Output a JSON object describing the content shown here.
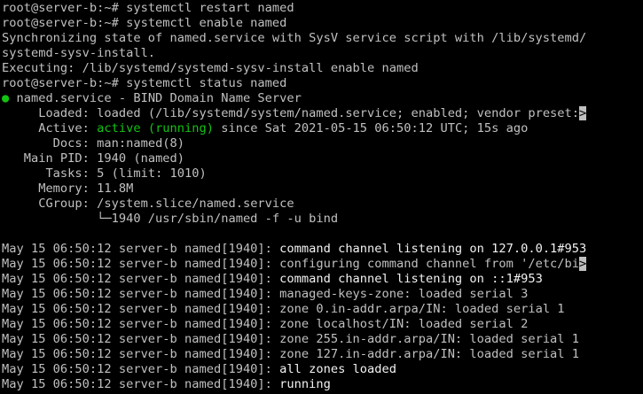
{
  "colors": {
    "background": "#000000",
    "text": "#c0c0c0",
    "green": "#13c313",
    "bright": "#f2f2f2"
  },
  "session": {
    "cmd1": {
      "prompt": "root@server-b:~# ",
      "command": "systemctl restart named"
    },
    "cmd2": {
      "prompt": "root@server-b:~# ",
      "command": "systemctl enable named"
    },
    "sync1": "Synchronizing state of named.service with SysV service script with /lib/systemd/",
    "sync2": "systemd-sysv-install.",
    "exec": "Executing: /lib/systemd/systemd-sysv-install enable named",
    "cmd3": {
      "prompt": "root@server-b:~# ",
      "command": "systemctl status named"
    }
  },
  "status": {
    "dot": "●",
    "unit": " named.service - BIND Domain Name Server",
    "loaded_label": "     Loaded: ",
    "loaded_value": "loaded (/lib/systemd/system/named.service; enabled; vendor preset:",
    "overflow_marker": ">",
    "active_label": "     Active: ",
    "active_state": "active (running)",
    "active_since": " since Sat 2021-05-15 06:50:12 UTC; 15s ago",
    "docs_label": "       Docs: ",
    "docs_value": "man:named(8)",
    "pid_label": "   Main PID: ",
    "pid_value": "1940 (named)",
    "tasks_label": "      Tasks: ",
    "tasks_value": "5 (limit: 1010)",
    "memory_label": "     Memory: ",
    "memory_value": "11.8M",
    "cgroup_label": "     CGroup: ",
    "cgroup_value": "/system.slice/named.service",
    "cgroup_tree": "             └─1940 /usr/sbin/named -f -u bind"
  },
  "log": {
    "prefix": "May 15 06:50:12 server-b named[1940]: ",
    "lines": [
      {
        "text": "command channel listening on 127.0.0.1#953",
        "bright": true
      },
      {
        "text": "configuring command channel from '/etc/bi",
        "bright": false,
        "overflow": ">"
      },
      {
        "text": "command channel listening on ::1#953",
        "bright": true
      },
      {
        "text": "managed-keys-zone: loaded serial 3",
        "bright": false
      },
      {
        "text": "zone 0.in-addr.arpa/IN: loaded serial 1",
        "bright": false
      },
      {
        "text": "zone localhost/IN: loaded serial 2",
        "bright": false
      },
      {
        "text": "zone 255.in-addr.arpa/IN: loaded serial 1",
        "bright": false
      },
      {
        "text": "zone 127.in-addr.arpa/IN: loaded serial 1",
        "bright": false
      },
      {
        "text": "all zones loaded",
        "bright": true
      },
      {
        "text": "running",
        "bright": true
      }
    ]
  }
}
